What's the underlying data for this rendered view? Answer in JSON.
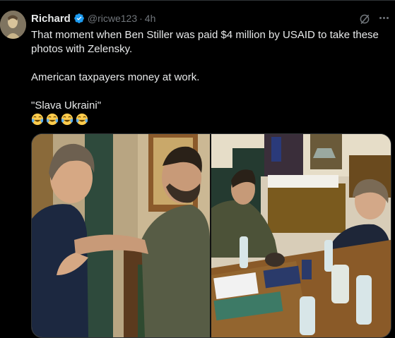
{
  "tweet": {
    "author_name": "Richard",
    "handle": "@ricwe123",
    "separator": "·",
    "time": "4h",
    "text_line1": "That moment when Ben Stiller was paid $4 million by USAID to take these photos with Zelensky.",
    "text_line2": "American taxpayers money at work.",
    "text_line3": "\"Slava Ukraini\"",
    "emojis": [
      "tears-of-joy",
      "tears-of-joy",
      "tears-of-joy",
      "tears-of-joy"
    ]
  },
  "colors": {
    "background": "#000000",
    "text": "#e7e9ea",
    "muted": "#71767b",
    "verified": "#1d9bf0",
    "border": "#2f3336"
  },
  "icons": {
    "verified": "verified-badge-icon",
    "grok": "grok-icon",
    "more": "more-options-icon"
  }
}
